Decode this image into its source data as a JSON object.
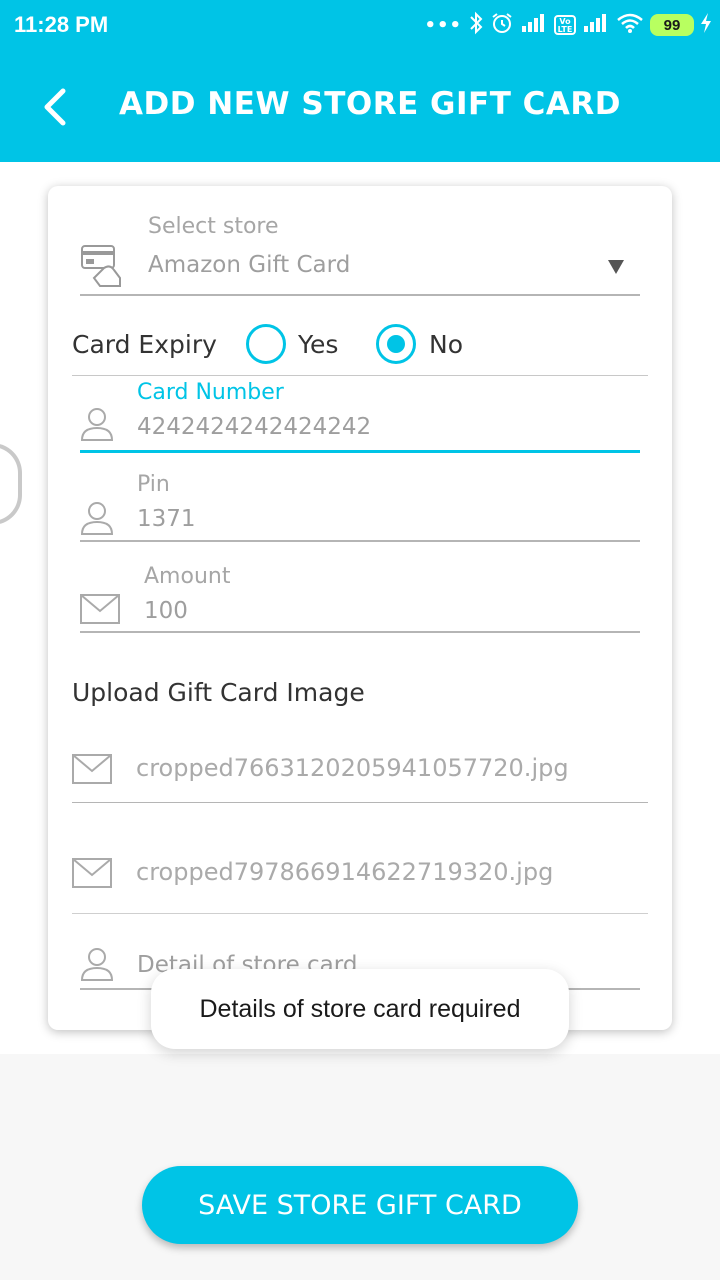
{
  "status_bar": {
    "time": "11:28 PM",
    "battery": "99"
  },
  "app_bar": {
    "title": "ADD NEW STORE GIFT CARD"
  },
  "form": {
    "store": {
      "label": "Select store",
      "value": "Amazon Gift Card"
    },
    "card_expiry": {
      "label": "Card Expiry",
      "options": [
        "Yes",
        "No"
      ],
      "selected": "No"
    },
    "card_number": {
      "label": "Card Number",
      "value": "4242424242424242"
    },
    "pin": {
      "label": "Pin",
      "value": "1371"
    },
    "amount": {
      "label": "Amount",
      "value": "100"
    },
    "upload": {
      "title": "Upload Gift Card Image",
      "files": [
        "cropped7663120205941057720.jpg",
        "cropped797866914622719320.jpg"
      ]
    },
    "details": {
      "placeholder": "Detail of store card"
    }
  },
  "toast": {
    "message": "Details of store card required"
  },
  "save_button": {
    "label": "SAVE STORE GIFT CARD"
  },
  "colors": {
    "accent": "#00c4e6",
    "underline": "#b5b5b5",
    "hint": "#a6a6a6"
  }
}
